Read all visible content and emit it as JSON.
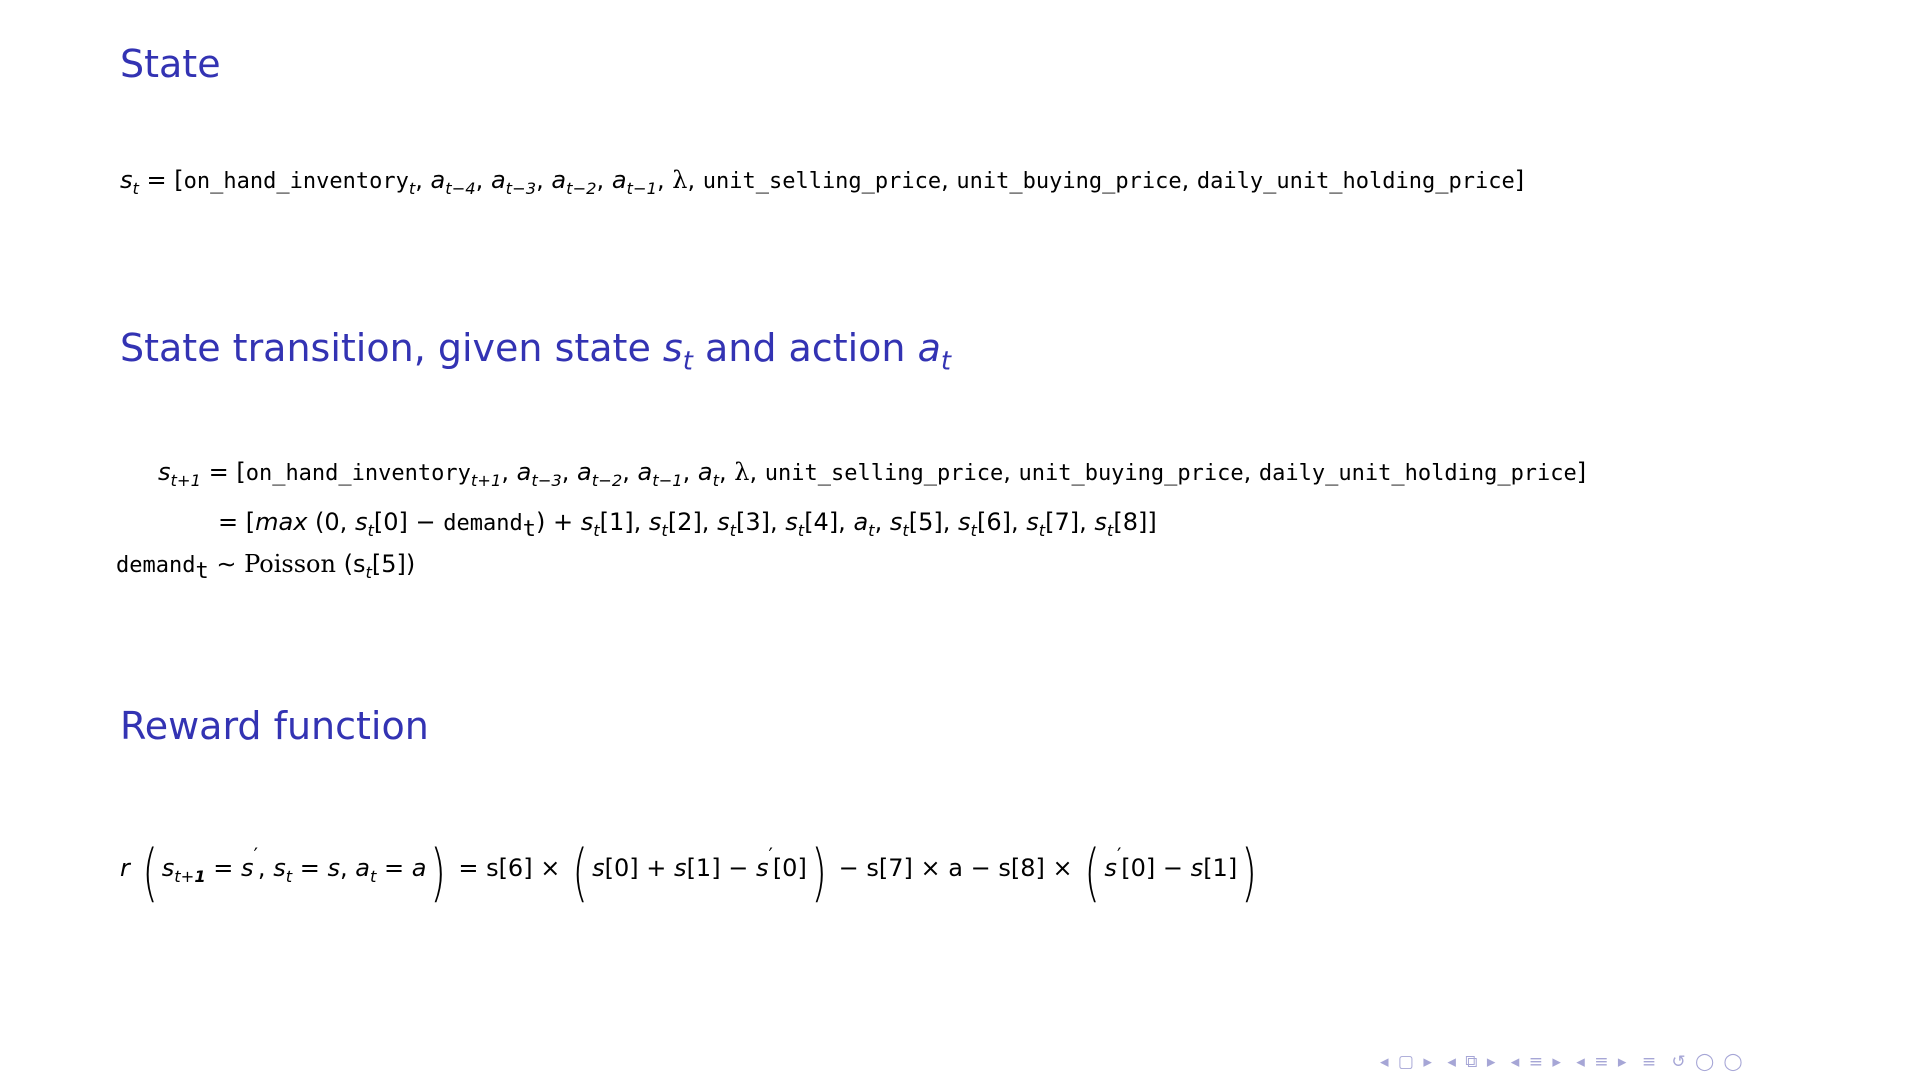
{
  "sections": [
    {
      "title": "State"
    },
    {
      "title_text": "State transition, given state ",
      "title_s": "s",
      "title_sub": "t",
      "title_mid": " and action ",
      "title_a": "a",
      "title_sub2": "t"
    },
    {
      "title": "Reward function"
    }
  ],
  "state_eq": {
    "lhs": "s",
    "lhs_sub": "t",
    "eq": " = [",
    "inv": "on_hand_inventory",
    "inv_sub": "t",
    "a": "a",
    "a4_sub": "t−4",
    "a3_sub": "t−3",
    "a2_sub": "t−2",
    "a1_sub": "t−1",
    "lambda": "λ",
    "sell": "unit_selling_price",
    "buy": "unit_buying_price",
    "hold": "daily_unit_holding_price",
    "close": "]"
  },
  "transition_eq": {
    "lhs": "s",
    "lhs_sub": "t+1",
    "eq": " = [",
    "inv": "on_hand_inventory",
    "inv_sub": "t+1",
    "a3_sub": "t−3",
    "a2_sub": "t−2",
    "a1_sub": "t−1",
    "at_sub": "t",
    "line2_prefix": "= [",
    "max": "max",
    "line2_body_a": " (0, ",
    "demand": "demand",
    "demand_sub": "t",
    "demand_line_sim": " ∼ ",
    "poisson": "Poisson",
    "poisson_arg": " (s",
    "poisson_idx": "[5])"
  },
  "reward_eq": {
    "r": "r",
    "rhs_6": "s[6] ×",
    "rhs_7": "− s[7] × a − s[8] ×"
  },
  "nav_icons": [
    "◂ ▢ ▸",
    "◂ ⧉ ▸",
    "◂ ≡ ▸",
    "◂ ≡ ▸",
    "≡",
    "↺ ◯ ◯"
  ]
}
